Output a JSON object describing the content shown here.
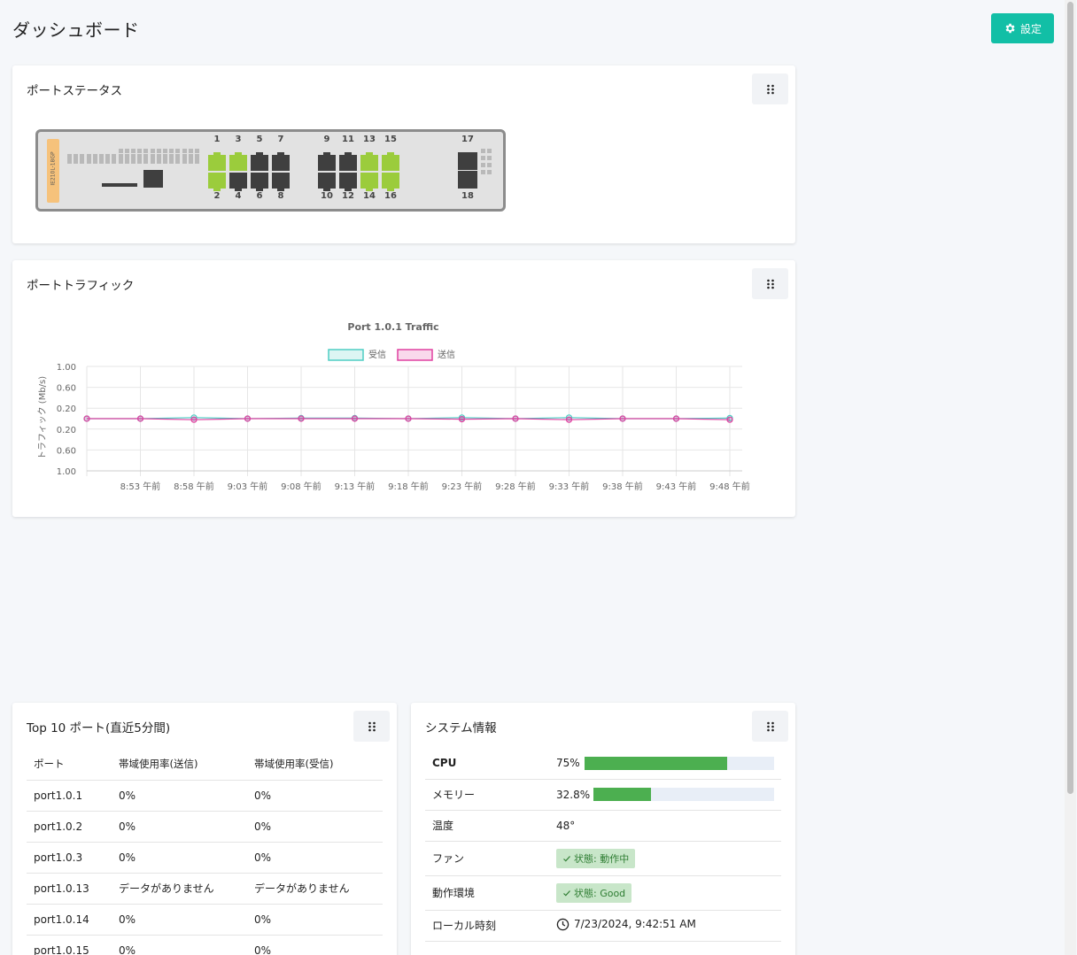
{
  "header": {
    "title": "ダッシュボード",
    "settings_label": "設定"
  },
  "port_status": {
    "title": "ポートステータス",
    "model": "IE210L-18GP",
    "ports": [
      {
        "num": "1",
        "status": "up"
      },
      {
        "num": "2",
        "status": "up"
      },
      {
        "num": "3",
        "status": "up"
      },
      {
        "num": "4",
        "status": "down"
      },
      {
        "num": "5",
        "status": "down"
      },
      {
        "num": "6",
        "status": "down"
      },
      {
        "num": "7",
        "status": "down"
      },
      {
        "num": "8",
        "status": "down"
      },
      {
        "num": "9",
        "status": "down"
      },
      {
        "num": "10",
        "status": "down"
      },
      {
        "num": "11",
        "status": "down"
      },
      {
        "num": "12",
        "status": "down"
      },
      {
        "num": "13",
        "status": "up"
      },
      {
        "num": "14",
        "status": "up"
      },
      {
        "num": "15",
        "status": "up"
      },
      {
        "num": "16",
        "status": "up"
      },
      {
        "num": "17",
        "status": "down"
      },
      {
        "num": "18",
        "status": "down"
      }
    ]
  },
  "traffic": {
    "title": "ポートトラフィック",
    "colors": {
      "receive": "#4ecdc4",
      "send": "#e040a0"
    }
  },
  "chart_data": {
    "type": "line",
    "title": "Port 1.0.1 Traffic",
    "ylabel": "トラフィック (Mb/s)",
    "xlabel": "",
    "y_tick_labels": [
      "1.00",
      "0.60",
      "0.20",
      "0.20",
      "0.60",
      "1.00"
    ],
    "ylim": [
      -1,
      1
    ],
    "grid": true,
    "legend_position": "top",
    "x": [
      "8:53 午前",
      "8:58 午前",
      "9:03 午前",
      "9:08 午前",
      "9:13 午前",
      "9:18 午前",
      "9:23 午前",
      "9:28 午前",
      "9:33 午前",
      "9:38 午前",
      "9:43 午前",
      "9:48 午前"
    ],
    "series": [
      {
        "name": "受信",
        "values": [
          0,
          0,
          0.02,
          0,
          0.01,
          0.01,
          0,
          0.02,
          0,
          0.02,
          0,
          0,
          0.01
        ]
      },
      {
        "name": "送信",
        "values": [
          0,
          0,
          -0.02,
          0,
          0,
          0,
          0,
          -0.01,
          0,
          -0.02,
          0,
          0,
          -0.02
        ]
      }
    ]
  },
  "top10": {
    "title": "Top 10 ポート(直近5分間)",
    "headers": [
      "ポート",
      "帯域使用率(送信)",
      "帯域使用率(受信)"
    ],
    "rows": [
      [
        "port1.0.1",
        "0%",
        "0%"
      ],
      [
        "port1.0.2",
        "0%",
        "0%"
      ],
      [
        "port1.0.3",
        "0%",
        "0%"
      ],
      [
        "port1.0.13",
        "データがありません",
        "データがありません"
      ],
      [
        "port1.0.14",
        "0%",
        "0%"
      ],
      [
        "port1.0.15",
        "0%",
        "0%"
      ]
    ]
  },
  "system": {
    "title": "システム情報",
    "cpu_label": "CPU",
    "cpu_value": "75%",
    "cpu_fraction": 0.75,
    "memory_label": "メモリー",
    "memory_value": "32.8%",
    "memory_fraction": 0.32,
    "temp_label": "温度",
    "temp_value": "48°",
    "fan_label": "ファン",
    "fan_status": "状態: 動作中",
    "env_label": "動作環境",
    "env_status": "状態: Good",
    "time_label": "ローカル時刻",
    "time_value": "7/23/2024, 9:42:51 AM"
  }
}
